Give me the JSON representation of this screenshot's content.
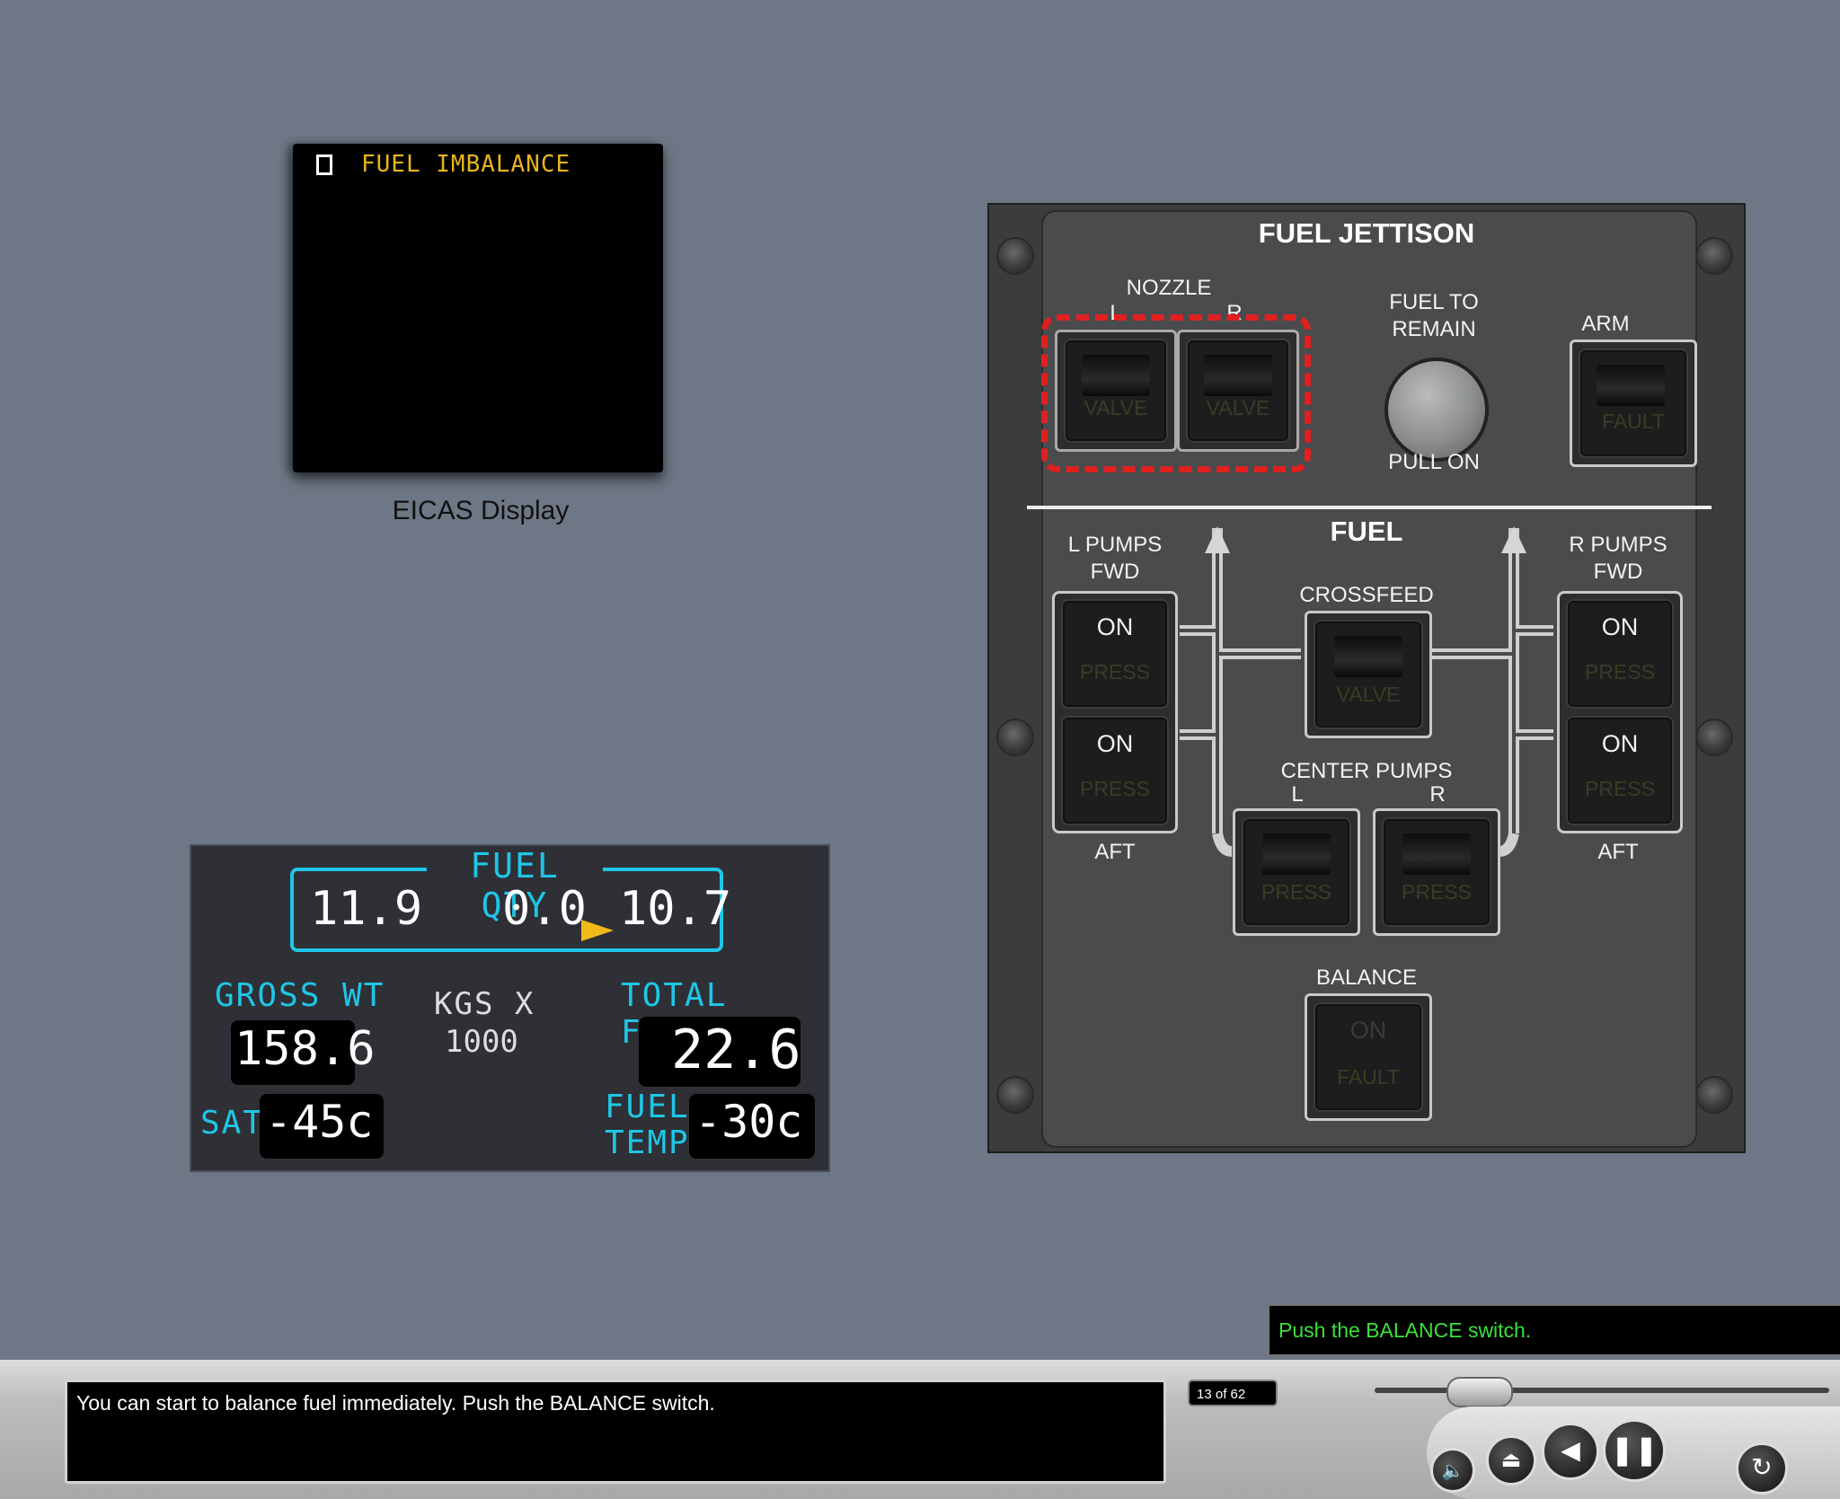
{
  "eicas": {
    "message": "FUEL IMBALANCE",
    "caption": "EICAS Display"
  },
  "fuel_qty_display": {
    "title": "FUEL QTY",
    "left_tank": "11.9",
    "center_tank": "0.0",
    "right_tank": "10.7",
    "gross_wt_label": "GROSS WT",
    "gross_wt_value": "158.6",
    "units_line1": "KGS X",
    "units_line2": "1000",
    "total_fuel_label": "TOTAL FUEL",
    "total_fuel_value": "22.6",
    "sat_label": "SAT",
    "sat_value": "-45c",
    "fuel_temp_label_1": "FUEL",
    "fuel_temp_label_2": "TEMP",
    "fuel_temp_value": "-30c",
    "arrow_color": "#f2b91a",
    "accent_color": "#1fc6e6"
  },
  "fuel_jettison_panel": {
    "title": "FUEL JETTISON",
    "nozzle_label": "NOZZLE",
    "nozzle_l": "L",
    "nozzle_r": "R",
    "nozzle_legend": "VALVE",
    "fuel_to_remain_line1": "FUEL TO",
    "fuel_to_remain_line2": "REMAIN",
    "pull_on": "PULL ON",
    "arm_label": "ARM",
    "arm_legend": "FAULT",
    "fuel_title": "FUEL",
    "l_pumps_line1": "L PUMPS",
    "l_pumps_line2": "FWD",
    "r_pumps_line1": "R PUMPS",
    "r_pumps_line2": "FWD",
    "aft_label": "AFT",
    "on_label": "ON",
    "press_label": "PRESS",
    "crossfeed_label": "CROSSFEED",
    "crossfeed_legend": "VALVE",
    "center_pumps_label": "CENTER PUMPS",
    "center_l": "L",
    "center_r": "R",
    "balance_label": "BALANCE",
    "balance_on": "ON",
    "balance_fault": "FAULT"
  },
  "footer": {
    "narration": "You can start to balance fuel immediately. Push the BALANCE switch.",
    "page_count": "13 of 62",
    "instruction": "Push the BALANCE switch.",
    "instruction_color": "#3ce03c",
    "controls": [
      "volume-icon",
      "eject-icon",
      "back-icon",
      "pause-icon",
      "replay-icon"
    ]
  }
}
